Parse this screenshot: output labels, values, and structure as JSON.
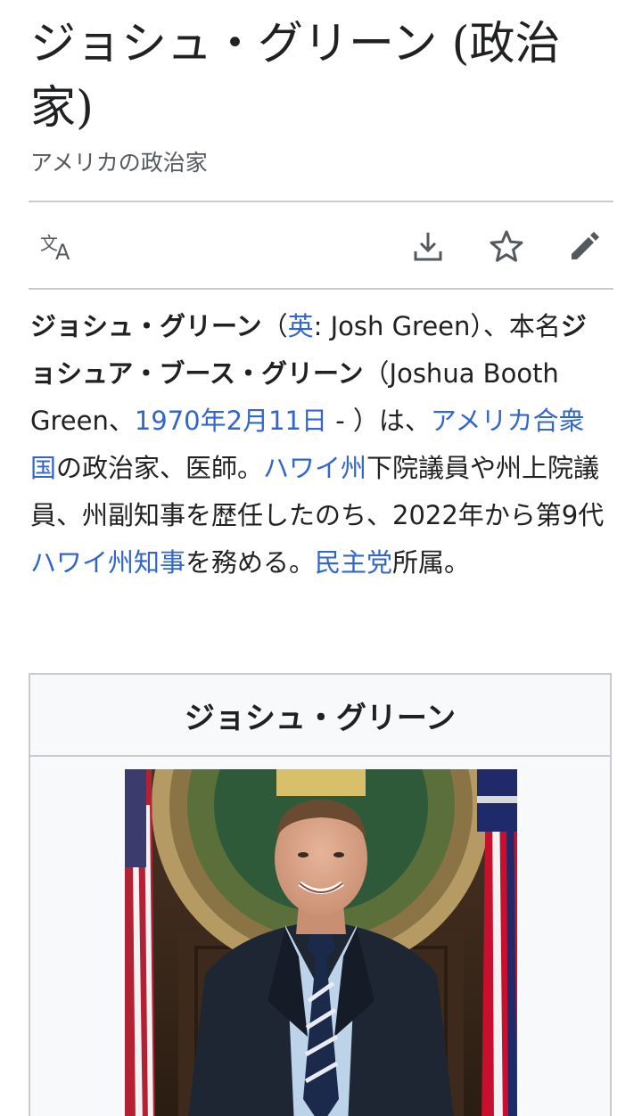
{
  "article": {
    "title": "ジョシュ・グリーン (政治家)",
    "description": "アメリカの政治家"
  },
  "toolbar": {
    "language_icon": "translate-icon",
    "download_icon": "download-icon",
    "watch_icon": "star-icon",
    "edit_icon": "pencil-icon"
  },
  "intro": {
    "name_bold": "ジョシュ・グリーン",
    "paren_open": "（",
    "lang_link": "英",
    "lang_text": ": Josh Green）、本名",
    "real_name_bold": "ジョシュア・ブース・グリーン",
    "real_name_en": "（Joshua Booth Green、",
    "birth_date_link": "1970年2月11日",
    "birth_suffix": " - ）は、",
    "country_link": "アメリカ合衆国",
    "text_1": "の政治家、医師。",
    "state_link": "ハワイ州",
    "text_2": "下院議員や州上院議員、州副知事を歴任したのち、2022年から第9代",
    "governor_link": "ハワイ州知事",
    "text_3": "を務める。",
    "party_link": "民主党",
    "text_4": "所属。"
  },
  "infobox": {
    "caption": "ジョシュ・グリーン"
  },
  "colors": {
    "link": "#3366cc",
    "text": "#202122",
    "muted": "#54595d",
    "border": "#c8ccd1"
  }
}
